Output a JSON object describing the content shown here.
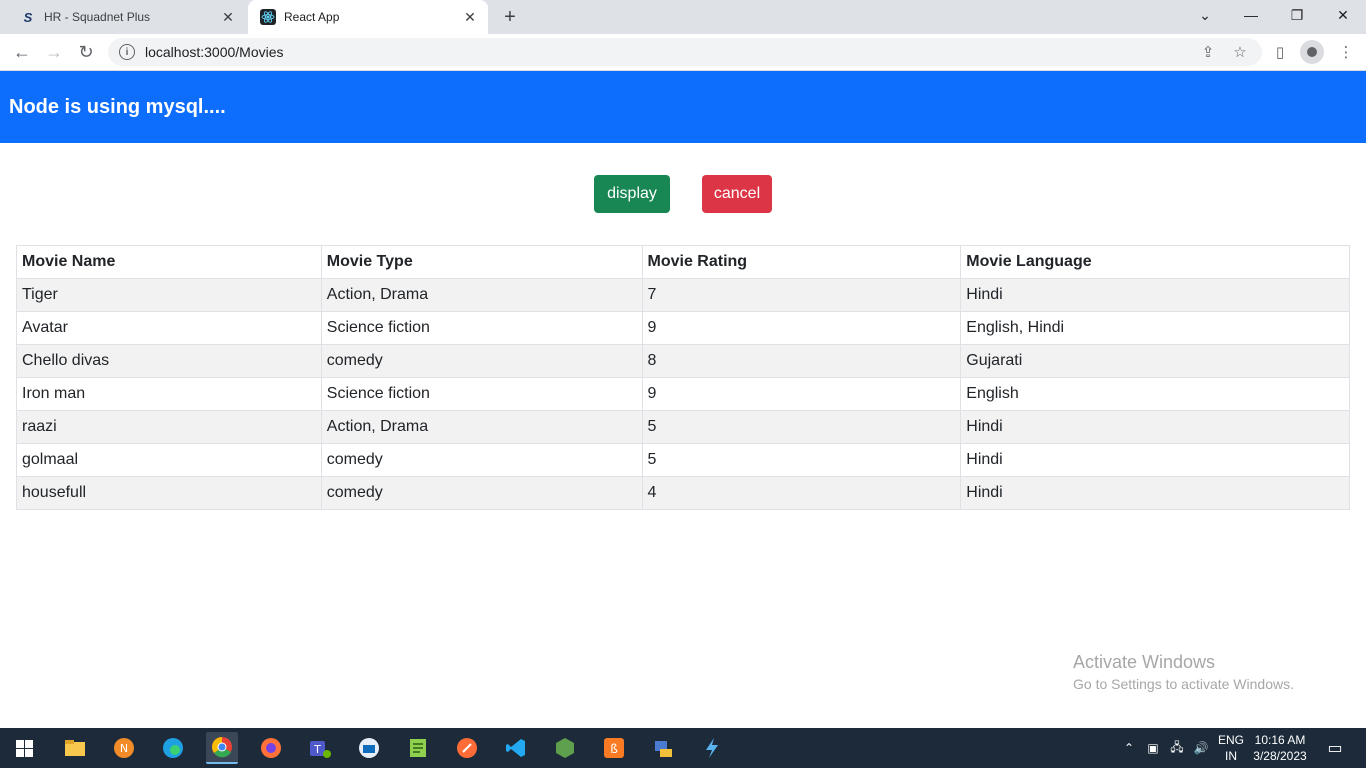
{
  "browser": {
    "tabs": [
      {
        "title": "HR - Squadnet Plus",
        "favicon": "S"
      },
      {
        "title": "React App",
        "favicon": "react-logo"
      }
    ],
    "url": "localhost:3000/Movies"
  },
  "page": {
    "header": "Node is using mysql....",
    "buttons": {
      "display": "display",
      "cancel": "cancel"
    },
    "colors": {
      "header": "#0d6efd",
      "display": "#198754",
      "cancel": "#dc3545"
    }
  },
  "table": {
    "headers": [
      "Movie Name",
      "Movie Type",
      "Movie Rating",
      "Movie Language"
    ],
    "rows": [
      [
        "Tiger",
        "Action, Drama",
        "7",
        "Hindi"
      ],
      [
        "Avatar",
        "Science fiction",
        "9",
        "English, Hindi"
      ],
      [
        "Chello divas",
        "comedy",
        "8",
        "Gujarati"
      ],
      [
        "Iron man",
        "Science fiction",
        "9",
        "English"
      ],
      [
        "raazi",
        "Action, Drama",
        "5",
        "Hindi"
      ],
      [
        "golmaal",
        "comedy",
        "5",
        "Hindi"
      ],
      [
        "housefull",
        "comedy",
        "4",
        "Hindi"
      ]
    ]
  },
  "watermark": {
    "line1": "Activate Windows",
    "line2": "Go to Settings to activate Windows."
  },
  "taskbar": {
    "lang1": "ENG",
    "lang2": "IN",
    "time": "10:16 AM",
    "date": "3/28/2023"
  }
}
